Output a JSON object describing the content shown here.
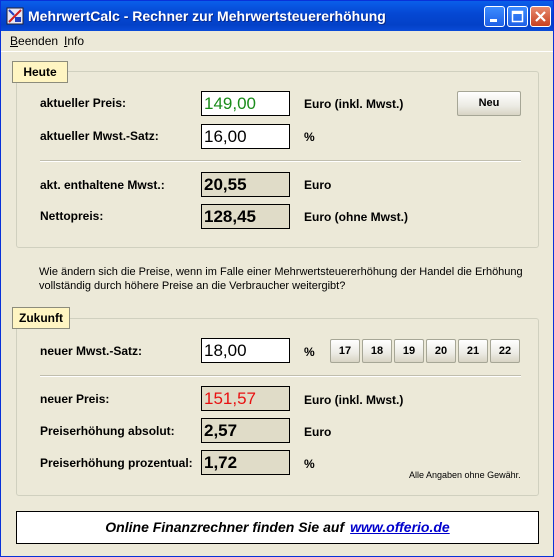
{
  "window": {
    "title": "MehrwertCalc - Rechner zur Mehrwertsteuererhöhung",
    "icon": "calculator-icon"
  },
  "menu": {
    "beenden_acc": "B",
    "beenden_rest": "eenden",
    "info_acc": "I",
    "info_rest": "nfo"
  },
  "heute": {
    "title": "Heute",
    "preis_label": "aktueller Preis:",
    "preis_value": "149,00",
    "preis_unit": "Euro (inkl. Mwst.)",
    "mwst_label": "aktueller Mwst.-Satz:",
    "mwst_value": "16,00",
    "mwst_unit": "%",
    "neu_button": "Neu",
    "enthalten_label": "akt. enthaltene Mwst.:",
    "enthalten_value": "20,55",
    "enthalten_unit": "Euro",
    "netto_label": "Nettopreis:",
    "netto_value": "128,45",
    "netto_unit": "Euro (ohne Mwst.)"
  },
  "question": "Wie ändern sich die Preise, wenn im Falle einer Mehrwertsteuererhöhung der Handel die Erhöhung vollständig durch höhere Preise an die Verbraucher weitergibt?",
  "zukunft": {
    "title": "Zukunft",
    "mwst_label": "neuer Mwst.-Satz:",
    "mwst_value": "18,00",
    "mwst_unit": "%",
    "rate_buttons": [
      "17",
      "18",
      "19",
      "20",
      "21",
      "22"
    ],
    "preis_label": "neuer Preis:",
    "preis_value": "151,57",
    "preis_unit": "Euro (inkl. Mwst.)",
    "abs_label": "Preiserhöhung absolut:",
    "abs_value": "2,57",
    "abs_unit": "Euro",
    "proz_label": "Preiserhöhung prozentual:",
    "proz_value": "1,72",
    "proz_unit": "%",
    "disclaimer": "Alle Angaben ohne Gewähr."
  },
  "footer": {
    "text": "Online Finanzrechner finden Sie auf",
    "link": "www.offerio.de"
  },
  "colors": {
    "preis_green": "#1A8C1A",
    "neuer_preis_red": "#E81010"
  }
}
